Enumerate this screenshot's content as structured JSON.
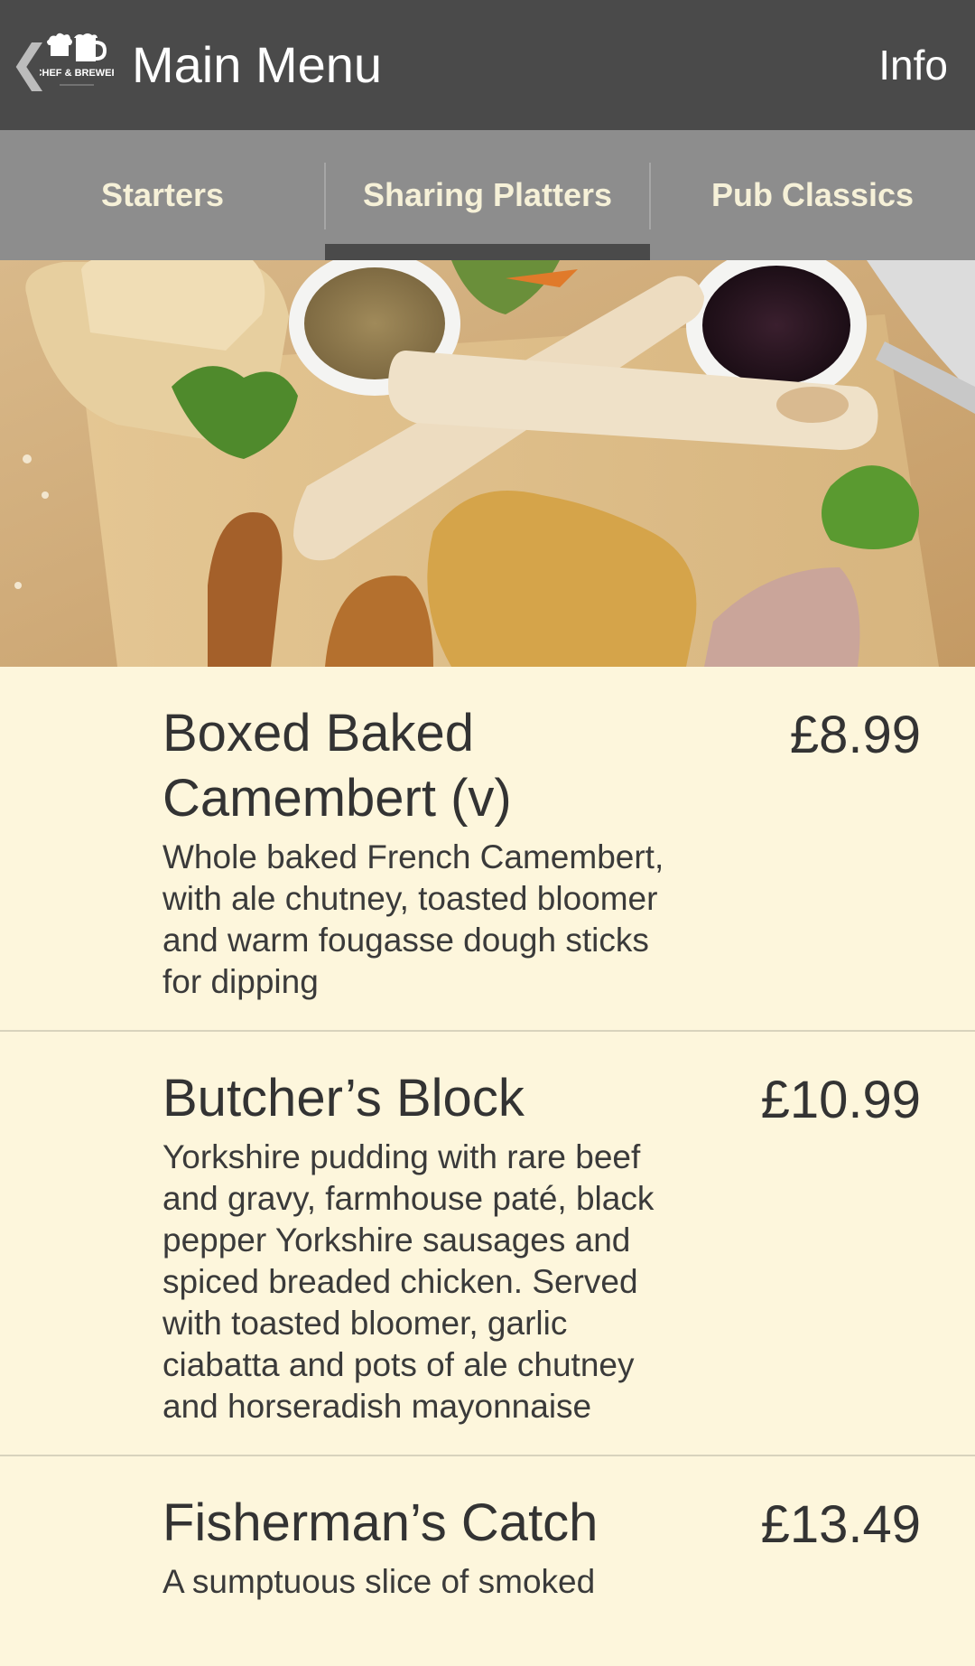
{
  "appbar": {
    "back_glyph": "❮",
    "logo_text": "CHEF & BREWER",
    "title": "Main Menu",
    "info_label": "Info"
  },
  "tabs": [
    {
      "label": "Starters",
      "selected": false
    },
    {
      "label": "Sharing Platters",
      "selected": true
    },
    {
      "label": "Pub Classics",
      "selected": false
    }
  ],
  "menu": {
    "items": [
      {
        "name": "Boxed Baked Camembert (v)",
        "price": "£8.99",
        "description": "Whole baked French Camembert, with ale chutney, toasted bloomer and warm fougasse dough sticks for dipping"
      },
      {
        "name": "Butcher’s Block",
        "price": "£10.99",
        "description": "Yorkshire pudding with rare beef and gravy, farmhouse paté, black pepper Yorkshire sausages and spiced breaded chicken. Served with toasted bloomer, garlic ciabatta and pots of ale chutney and horseradish mayonnaise"
      },
      {
        "name": "Fisherman’s Catch",
        "price": "£13.49",
        "description": "A sumptuous slice of smoked"
      }
    ]
  },
  "colors": {
    "appbar": "#4a4a4a",
    "tabbar": "#8d8d8d",
    "tab_text": "#f6f1d8",
    "background": "#fdf6dc"
  }
}
